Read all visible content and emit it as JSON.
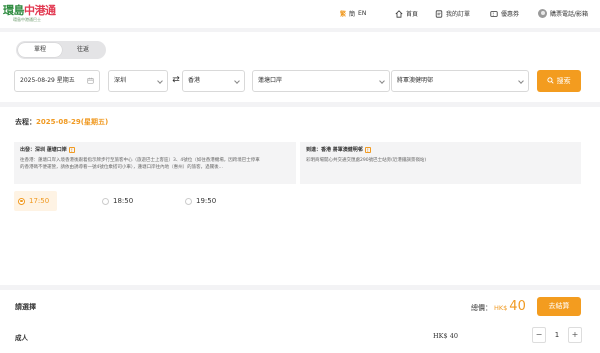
{
  "header": {
    "logo_green": "環島",
    "logo_red": "中港通",
    "logo_sub": "環島中港通巴士",
    "lang_traditional": "繁",
    "lang_simplified": "簡",
    "lang_english": "EN",
    "nav": {
      "home": "首頁",
      "orders": "我的訂單",
      "coupons": "優惠券",
      "login": "購票電話/影箱"
    },
    "icons": {
      "home": "home-icon",
      "orders": "orders-icon",
      "coupons": "coupon-icon",
      "user": "user-avatar-icon"
    }
  },
  "search": {
    "trip_types": [
      "單程",
      "往返"
    ],
    "selected_trip": "單程",
    "date": "2025-08-29",
    "weekday": "星期五",
    "from_city": "深圳",
    "to_city": "香港",
    "from_stop": "蓮塘口岸",
    "to_stop": "將軍澳健明邨",
    "search_button": "搜索"
  },
  "schedule": {
    "outbound_label": "去程：",
    "outbound_date": "2025-08-29(星期五)",
    "departure": {
      "title": "出發：深圳 蓮塘口岸",
      "line1": "往香港：蓮塘口岸入境香港後跟着指示牌步行至旅客中心（旅遊巴士上客區）3、4號位（如往香港機場，因跨境巴士停車",
      "line2": "的香港碼不便運營，請依由誘導看一號4號位乘搭司小車），蓮塘口岸往內地（惠州）的旅客，過關後..."
    },
    "arrival": {
      "title": "到達：香港 將軍澳健明邨",
      "line1": "彩明商場開心共交通交匯處290號巴士站旁(近港鐵調景嶺站)"
    },
    "times": [
      "17:50",
      "18:50",
      "19:50"
    ],
    "selected_time": "17:50"
  },
  "tickets": {
    "choose_label": "請選擇",
    "total_label": "總價：",
    "total_currency": "HK$",
    "total_amount": "40",
    "checkout_button": "去結算",
    "passenger_type": "成人",
    "passenger_price": "HK$ 40",
    "quantity": "1",
    "minus": "−",
    "plus": "+"
  },
  "colors": {
    "accent": "#f39c1f",
    "brand_green": "#2d8a3e",
    "brand_red": "#e23a52"
  }
}
